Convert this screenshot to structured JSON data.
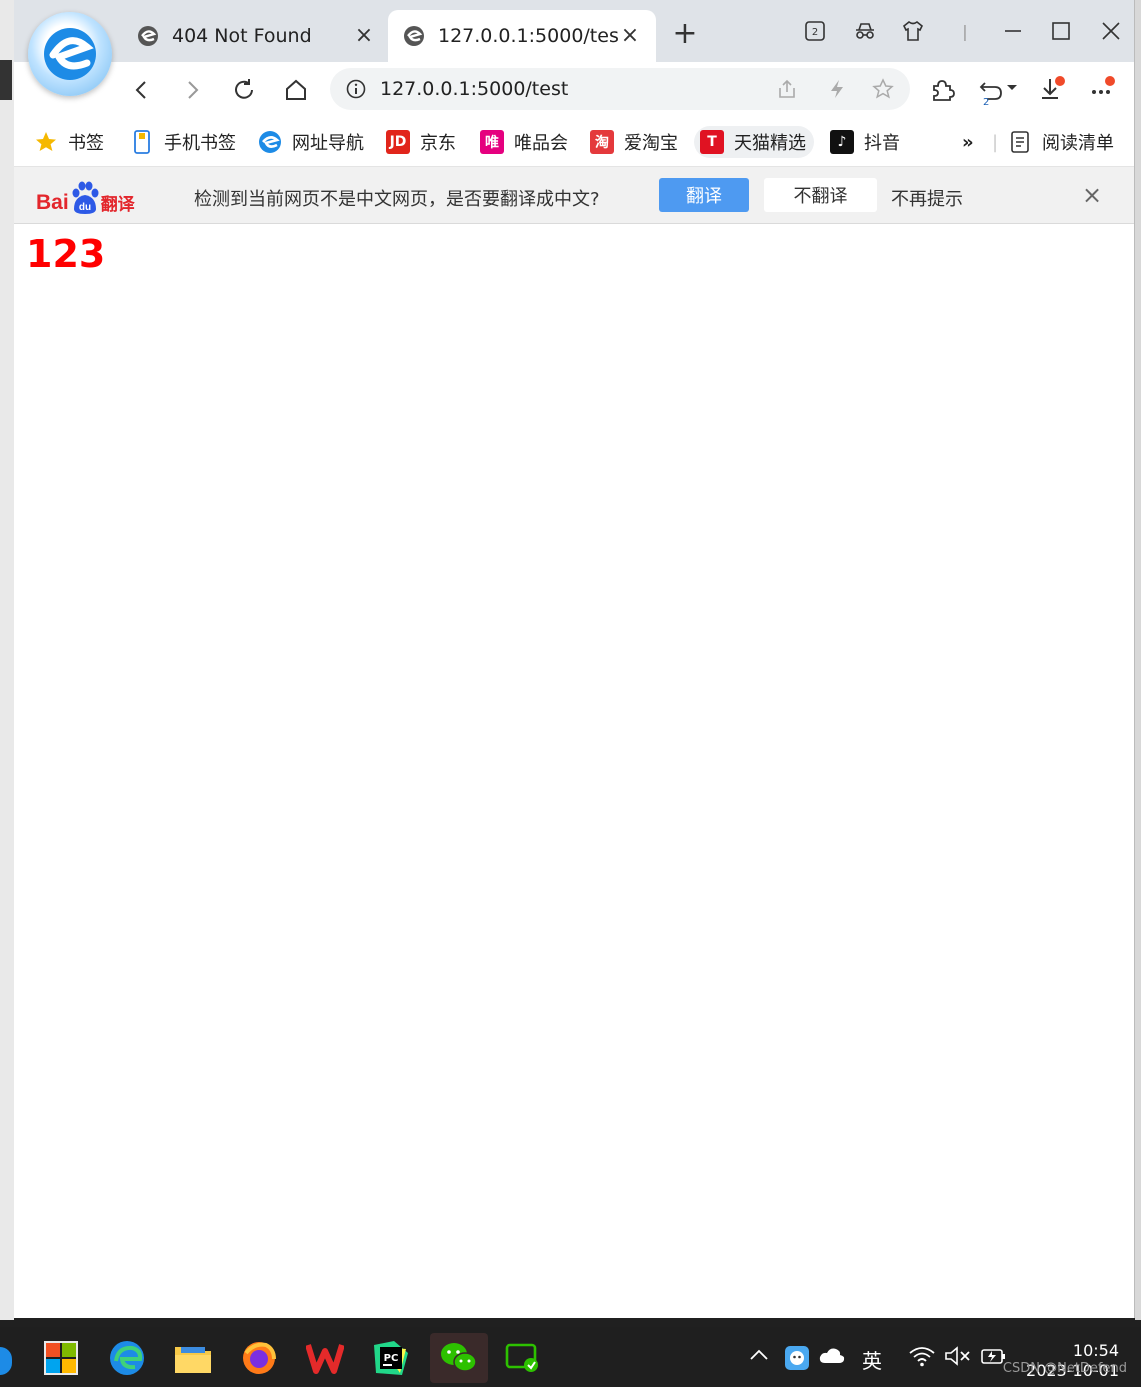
{
  "tabs": [
    {
      "label": "404 Not Found",
      "active": false
    },
    {
      "label": "127.0.0.1:5000/test",
      "active": true
    }
  ],
  "window_controls": {
    "tab_count": "2"
  },
  "address_bar": {
    "url": "127.0.0.1:5000/test"
  },
  "toolbar": {
    "history_badge": "2"
  },
  "bookmarks": [
    {
      "label": "书签",
      "icon": "star-icon"
    },
    {
      "label": "手机书签",
      "icon": "phone-icon"
    },
    {
      "label": "网址导航",
      "icon": "browser-e-icon"
    },
    {
      "label": "京东",
      "icon": "jd-icon",
      "icon_text": "JD",
      "color": "#e1251b"
    },
    {
      "label": "唯品会",
      "icon": "vip-icon",
      "icon_text": "唯",
      "color": "#e5007f"
    },
    {
      "label": "爱淘宝",
      "icon": "taobao-icon",
      "icon_text": "淘",
      "color": "#e4393c"
    },
    {
      "label": "天猫精选",
      "icon": "tmall-icon",
      "icon_text": "T",
      "color": "#e01222"
    },
    {
      "label": "抖音",
      "icon": "douyin-icon",
      "icon_text": "♪",
      "color": "#111111"
    },
    {
      "label": "»",
      "icon": ""
    },
    {
      "label": "阅读清单",
      "icon": "reading-list-icon"
    }
  ],
  "translate_bar": {
    "brand_left": "Bai",
    "brand_right": "翻译",
    "brand_paw_text": "du",
    "message": "检测到当前网页不是中文网页，是否要翻译成中文?",
    "translate_button": "翻译",
    "no_translate_button": "不翻译",
    "never_button": "不再提示",
    "close": "×"
  },
  "page": {
    "heading": "123"
  },
  "taskbar": {
    "tray_language": "英",
    "time": "10:54",
    "date": "2023-10-01",
    "watermark": "CSDN @NetDefend"
  },
  "colors": {
    "heading": "#ff0000",
    "accent": "#4e9af1"
  }
}
